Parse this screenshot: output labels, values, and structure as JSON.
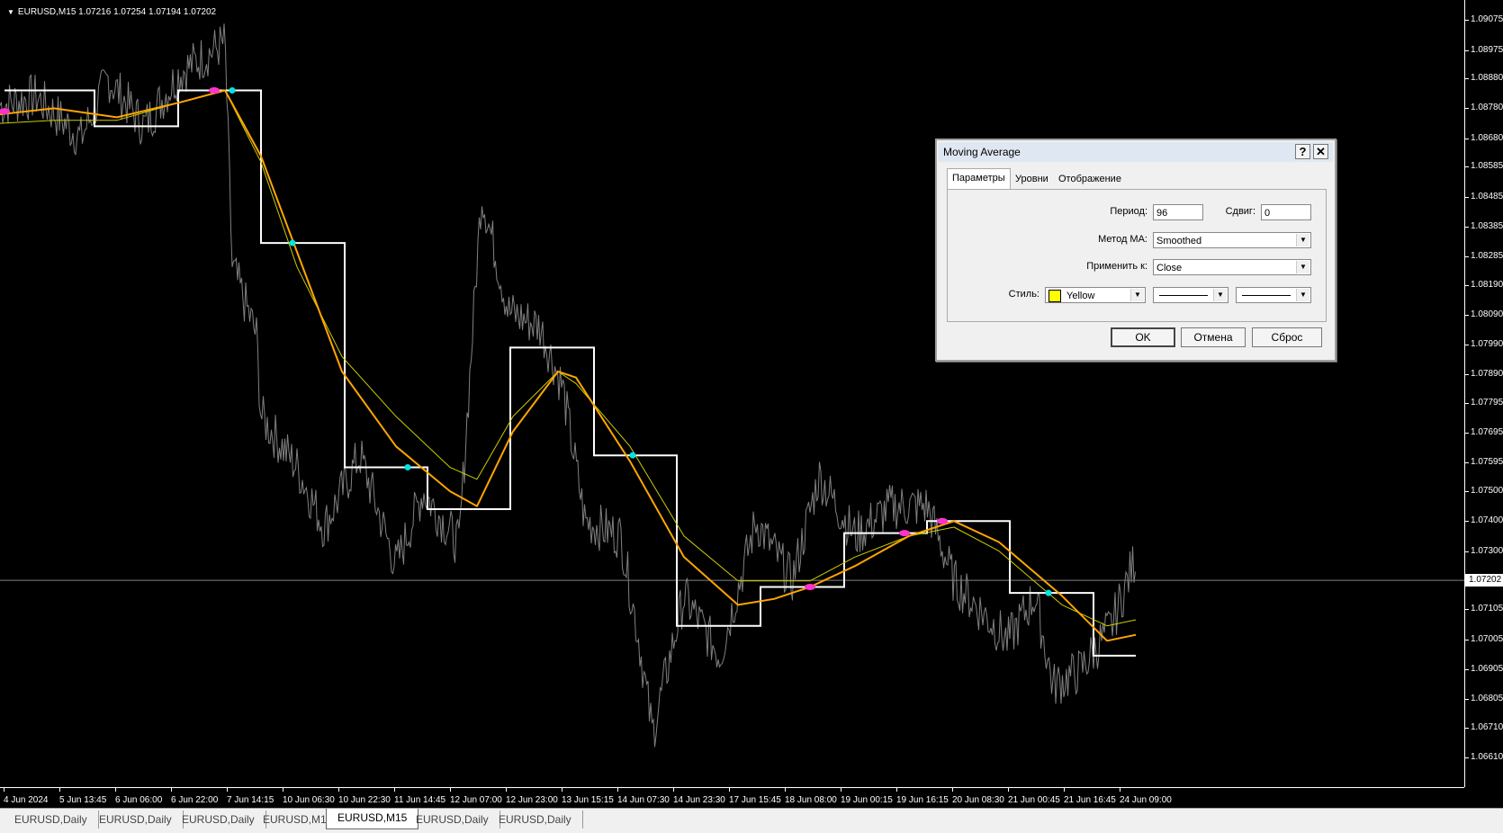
{
  "chart": {
    "symbol_text": "EURUSD,M15  1.07216 1.07254 1.07194 1.07202",
    "current_price": "1.07202",
    "price_min": 1.0661,
    "price_max": 1.0907,
    "price_labels": [
      "1.09075",
      "1.08975",
      "1.08880",
      "1.08780",
      "1.08680",
      "1.08585",
      "1.08485",
      "1.08385",
      "1.08285",
      "1.08190",
      "1.08090",
      "1.07990",
      "1.07890",
      "1.07795",
      "1.07695",
      "1.07595",
      "1.07500",
      "1.07400",
      "1.07300",
      "1.07202",
      "1.07105",
      "1.07005",
      "1.06905",
      "1.06805",
      "1.06710",
      "1.06610"
    ],
    "time_labels": [
      "4 Jun 2024",
      "5 Jun 13:45",
      "6 Jun 06:00",
      "6 Jun 22:00",
      "7 Jun 14:15",
      "10 Jun 06:30",
      "10 Jun 22:30",
      "11 Jun 14:45",
      "12 Jun 07:00",
      "12 Jun 23:00",
      "13 Jun 15:15",
      "14 Jun 07:30",
      "14 Jun 23:30",
      "17 Jun 15:45",
      "18 Jun 08:00",
      "19 Jun 00:15",
      "19 Jun 16:15",
      "20 Jun 08:30",
      "21 Jun 00:45",
      "21 Jun 16:45",
      "24 Jun 09:00"
    ],
    "colors": {
      "background": "#000000",
      "price": "#808080",
      "step": "#ffffff",
      "ma_fast": "#ffa500",
      "ma_slow": "#cccc00",
      "marker_up": "#00e5e5",
      "marker_down": "#ff33cc"
    }
  },
  "tabs": [
    {
      "label": "EURUSD,Daily",
      "active": false
    },
    {
      "label": "EURUSD,Daily",
      "active": false
    },
    {
      "label": "EURUSD,Daily",
      "active": false
    },
    {
      "label": "EURUSD,M1",
      "active": false
    },
    {
      "label": "EURUSD,M15",
      "active": true
    },
    {
      "label": "EURUSD,Daily",
      "active": false
    },
    {
      "label": "EURUSD,Daily",
      "active": false
    }
  ],
  "dialog": {
    "title": "Moving Average",
    "help": "?",
    "close": "✕",
    "tabs": [
      "Параметры",
      "Уровни",
      "Отображение"
    ],
    "period_label": "Период:",
    "period_value": "96",
    "shift_label": "Сдвиг:",
    "shift_value": "0",
    "method_label": "Метод МА:",
    "method_value": "Smoothed",
    "apply_label": "Применить к:",
    "apply_value": "Close",
    "style_label": "Стиль:",
    "color_value": "Yellow",
    "ok": "OK",
    "cancel": "Отмена",
    "reset": "Сброс"
  }
}
